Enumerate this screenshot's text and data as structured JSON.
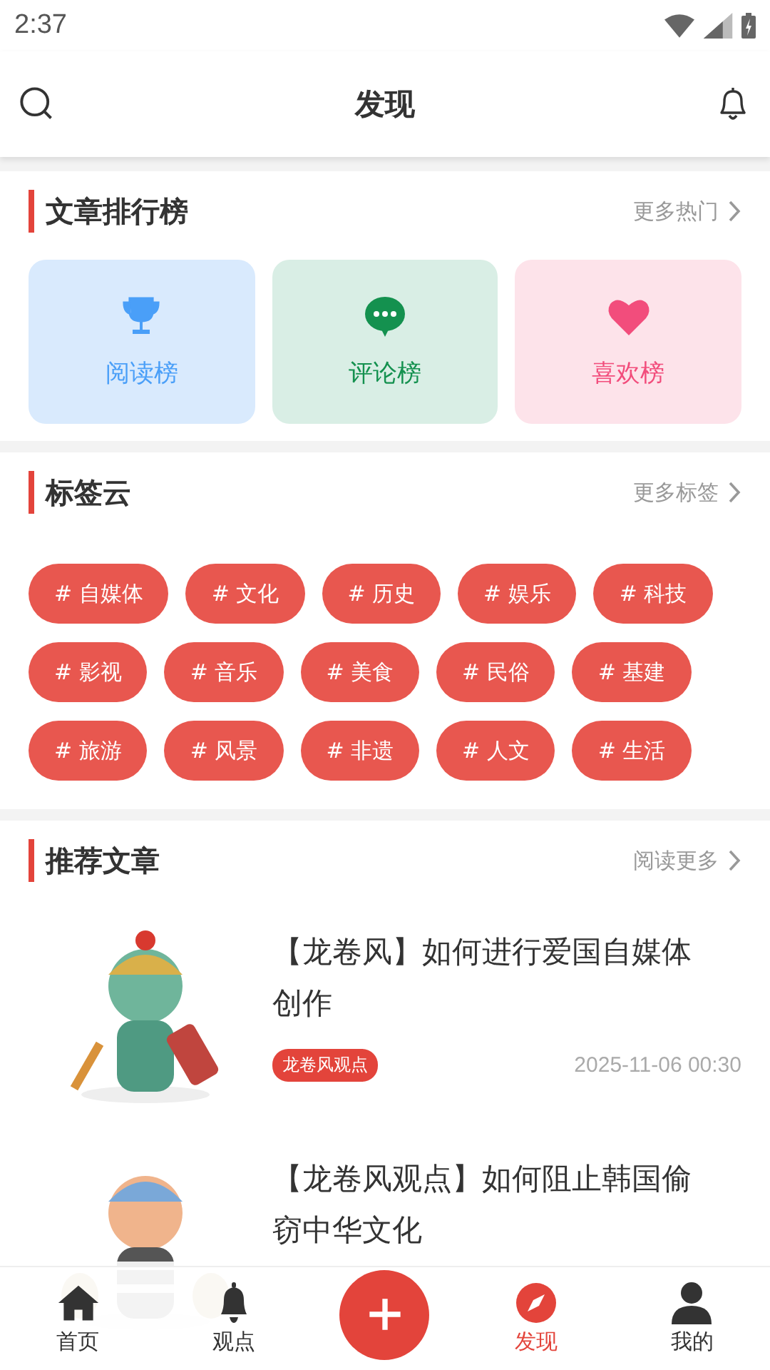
{
  "status_bar": {
    "time": "2:37"
  },
  "header": {
    "title": "发现"
  },
  "ranking": {
    "title": "文章排行榜",
    "more": "更多热门",
    "cards": [
      {
        "label": "阅读榜",
        "kind": "trophy"
      },
      {
        "label": "评论榜",
        "kind": "comment"
      },
      {
        "label": "喜欢榜",
        "kind": "heart"
      }
    ]
  },
  "tag_cloud": {
    "title": "标签云",
    "more": "更多标签",
    "tags": [
      {
        "label": "# 自媒体"
      },
      {
        "label": "# 文化"
      },
      {
        "label": "# 历史"
      },
      {
        "label": "# 娱乐"
      },
      {
        "label": "# 科技"
      },
      {
        "label": "# 影视"
      },
      {
        "label": "# 音乐"
      },
      {
        "label": "# 美食"
      },
      {
        "label": "# 民俗"
      },
      {
        "label": "# 基建"
      },
      {
        "label": "# 旅游"
      },
      {
        "label": "# 风景"
      },
      {
        "label": "# 非遗"
      },
      {
        "label": "# 人文"
      },
      {
        "label": "# 生活"
      }
    ]
  },
  "recommended": {
    "title": "推荐文章",
    "more": "阅读更多",
    "articles": [
      {
        "title": "【龙卷风】如何进行爱国自媒体创作",
        "tag": "龙卷风观点",
        "date": "2025-11-06 00:30"
      },
      {
        "title": "【龙卷风观点】如何阻止韩国偷窃中华文化"
      }
    ]
  },
  "bottom_nav": [
    {
      "label": "首页",
      "kind": "home",
      "selected": false
    },
    {
      "label": "观点",
      "kind": "bell",
      "selected": false
    },
    {
      "kind": "add"
    },
    {
      "label": "发现",
      "kind": "compass",
      "selected": true
    },
    {
      "label": "我的",
      "kind": "person",
      "selected": false
    }
  ]
}
